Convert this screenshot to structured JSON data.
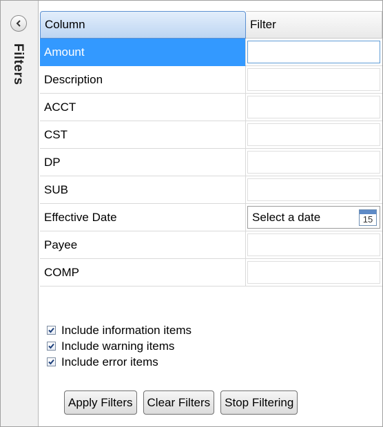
{
  "side_panel": {
    "title": "Filters",
    "collapse_icon": "chevron-left-icon"
  },
  "grid": {
    "headers": {
      "column": "Column",
      "filter": "Filter"
    },
    "rows": [
      {
        "column": "Amount",
        "filter": ""
      },
      {
        "column": "Description",
        "filter": ""
      },
      {
        "column": "ACCT",
        "filter": ""
      },
      {
        "column": "CST",
        "filter": ""
      },
      {
        "column": "DP",
        "filter": ""
      },
      {
        "column": "SUB",
        "filter": ""
      },
      {
        "column": "Effective Date",
        "filter": "Select a date",
        "calendar_day": "15"
      },
      {
        "column": "Payee",
        "filter": ""
      },
      {
        "column": "COMP",
        "filter": ""
      }
    ],
    "selected_row": "Amount"
  },
  "options": [
    {
      "label": "Include information items",
      "checked": true
    },
    {
      "label": "Include warning items",
      "checked": true
    },
    {
      "label": "Include error items",
      "checked": true
    }
  ],
  "buttons": {
    "apply": "Apply Filters",
    "clear": "Clear Filters",
    "stop": "Stop Filtering"
  },
  "colors": {
    "selection": "#3399ff",
    "header_accent": "#bcd5f2"
  }
}
